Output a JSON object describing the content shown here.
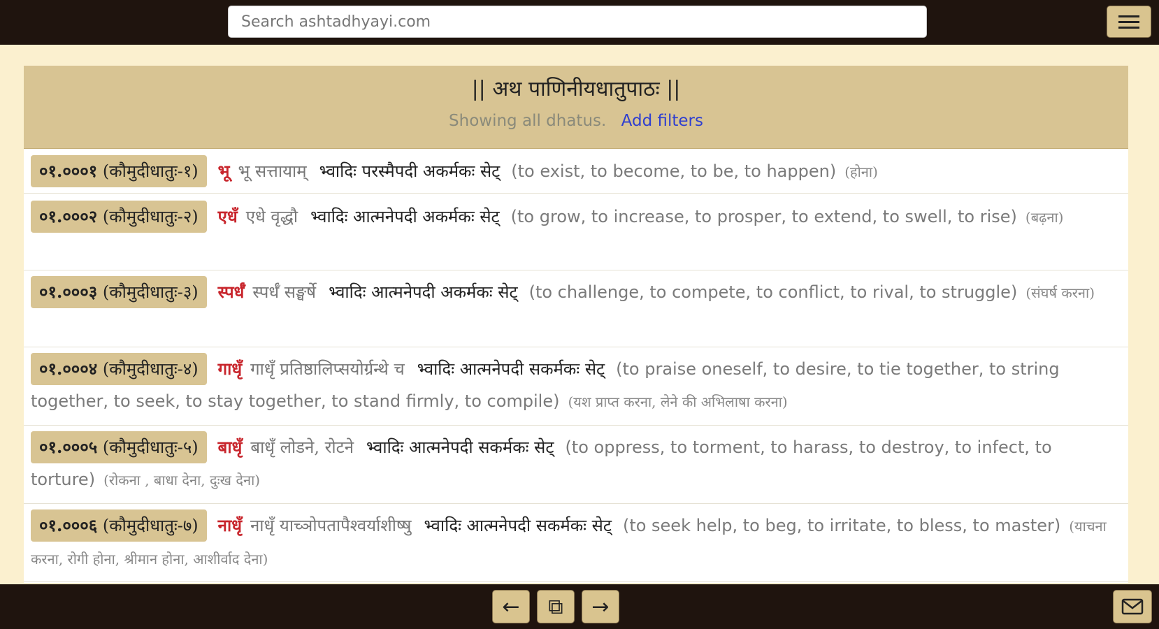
{
  "search": {
    "placeholder": "Search ashtadhyayi.com"
  },
  "header": {
    "title": "|| अथ पाणिनीयधातुपाठः ||",
    "status": "Showing all dhatus.",
    "filter_link": "Add filters"
  },
  "rows": [
    {
      "code": "०१.०००१",
      "kaumudi": "(कौमुदीधातुः-१)",
      "root": "भू",
      "sutra": "भू सत्तायाम्",
      "gana": "भ्वादिः परस्मैपदी अकर्मकः सेट्",
      "english": "(to exist, to become, to be, to happen)",
      "hindi": "(होना)"
    },
    {
      "code": "०१.०००२",
      "kaumudi": "(कौमुदीधातुः-२)",
      "root": "एधँ",
      "sutra": "एधे वृद्धौ",
      "gana": "भ्वादिः आत्मनेपदी अकर्मकः सेट्",
      "english": "(to grow, to increase, to prosper, to extend, to swell, to rise)",
      "hindi": "(बढ़ना)"
    },
    {
      "code": "०१.०००३",
      "kaumudi": "(कौमुदीधातुः-३)",
      "root": "स्पर्धँ",
      "sutra": "स्पर्धँ सङ्घर्षे",
      "gana": "भ्वादिः आत्मनेपदी अकर्मकः सेट्",
      "english": "(to challenge, to compete, to conflict, to rival, to struggle)",
      "hindi": "(संघर्ष करना)"
    },
    {
      "code": "०१.०००४",
      "kaumudi": "(कौमुदीधातुः-४)",
      "root": "गाधृँ",
      "sutra": "गाधृँ प्रतिष्ठालिप्सयोर्ग्रन्थे च",
      "gana": "भ्वादिः आत्मनेपदी सकर्मकः सेट्",
      "english": "(to praise oneself, to desire, to tie together, to string together, to seek, to stay together, to stand firmly, to compile)",
      "hindi": "(यश प्राप्त करना, लेने की अभिलाषा करना)"
    },
    {
      "code": "०१.०००५",
      "kaumudi": "(कौमुदीधातुः-५)",
      "root": "बाधृँ",
      "sutra": "बाधृँ लोडने, रोटने",
      "gana": "भ्वादिः आत्मनेपदी सकर्मकः सेट्",
      "english": "(to oppress, to torment, to harass, to destroy, to infect, to torture)",
      "hindi": "(रोकना , बाधा देना, दुःख देना)"
    },
    {
      "code": "०१.०००६",
      "kaumudi": "(कौमुदीधातुः-७)",
      "root": "नाधृँ",
      "sutra": "नाधृँ याच्ञोपतापैश्वर्याशीष्षु",
      "gana": "भ्वादिः आत्मनेपदी सकर्मकः सेट्",
      "english": "(to seek help, to beg, to irritate, to bless, to master)",
      "hindi": "(याचना करना, रोगी होना, श्रीमान होना, आशीर्वाद देना)"
    }
  ],
  "icons": {
    "menu": "hamburger-menu-icon",
    "prev": "←",
    "copy": "⧉",
    "next": "→",
    "mail": "envelope-icon"
  }
}
